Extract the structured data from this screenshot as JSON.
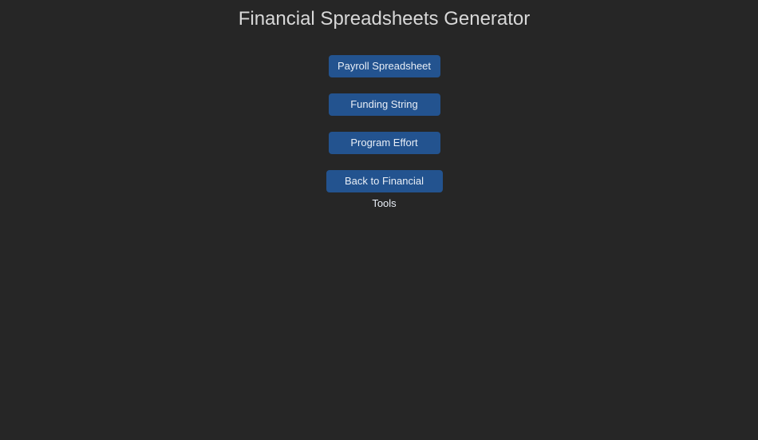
{
  "page": {
    "title": "Financial Spreadsheets Generator"
  },
  "buttons": {
    "payroll": "Payroll Spreadsheet",
    "funding": "Funding String",
    "program": "Program Effort",
    "back": "Back to Financial Tools"
  },
  "colors": {
    "background": "#262626",
    "button": "#23538f",
    "title_text": "#d8d8d8"
  }
}
